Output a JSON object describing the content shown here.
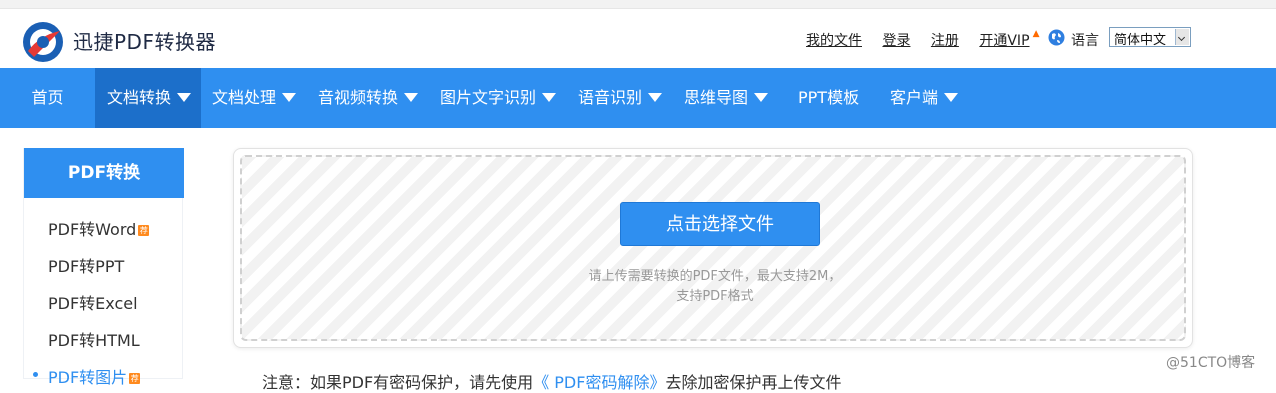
{
  "header": {
    "brand": "迅捷PDF转换器",
    "links": [
      "我的文件",
      "登录",
      "注册"
    ],
    "vip": "开通VIP",
    "lang_label": "语言",
    "lang_value": "简体中文"
  },
  "nav": [
    {
      "label": "首页",
      "dropdown": false
    },
    {
      "label": "文档转换",
      "dropdown": true,
      "active": true
    },
    {
      "label": "文档处理",
      "dropdown": true
    },
    {
      "label": "音视频转换",
      "dropdown": true
    },
    {
      "label": "图片文字识别",
      "dropdown": true
    },
    {
      "label": "语音识别",
      "dropdown": true
    },
    {
      "label": "思维导图",
      "dropdown": true
    },
    {
      "label": "PPT模板",
      "dropdown": false
    },
    {
      "label": "客户端",
      "dropdown": true
    }
  ],
  "sidebar": {
    "title": "PDF转换",
    "items": [
      {
        "label": "PDF转Word",
        "badge": true
      },
      {
        "label": "PDF转PPT"
      },
      {
        "label": "PDF转Excel"
      },
      {
        "label": "PDF转HTML"
      },
      {
        "label": "PDF转图片",
        "badge": true,
        "active": true
      }
    ]
  },
  "upload": {
    "button": "点击选择文件",
    "hint1": "请上传需要转换的PDF文件，最大支持2M，",
    "hint2": "支持PDF格式"
  },
  "notice": {
    "prefix": "注意：如果PDF有密码保护，请先使用",
    "link": "《 PDF密码解除》",
    "suffix": "去除加密保护再上传文件"
  },
  "watermark": "@51CTO博客",
  "colors": {
    "primary": "#2f8ff0",
    "nav_active": "#1c6fca",
    "badge": "#ff8a1e"
  }
}
